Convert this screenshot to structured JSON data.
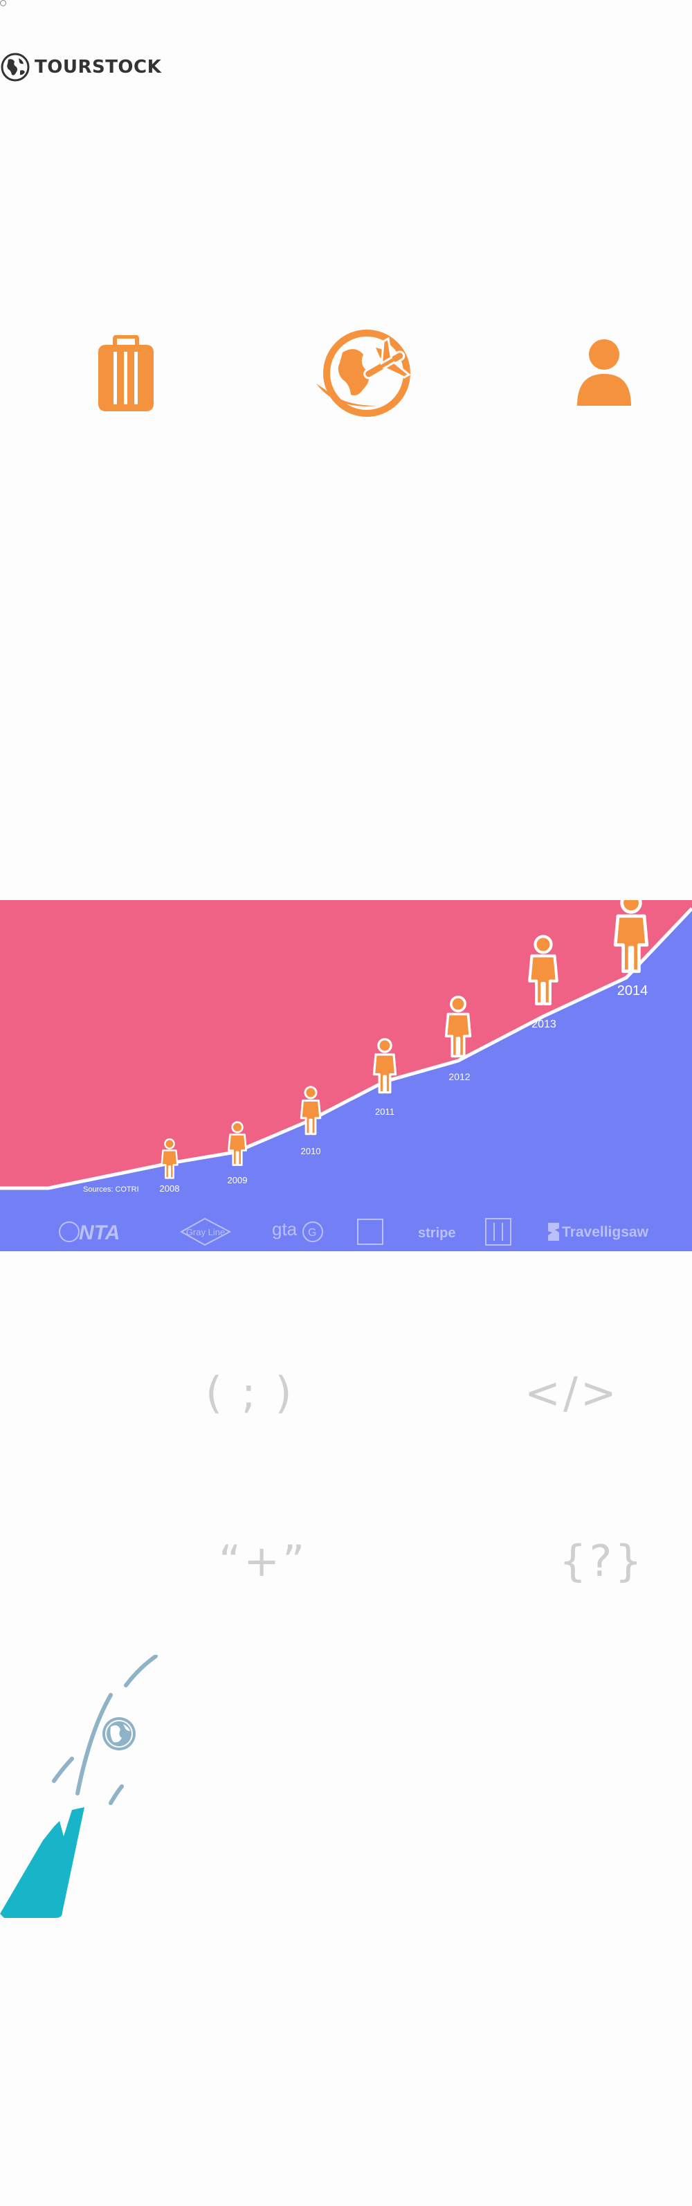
{
  "brand": {
    "name": "TOURSTOCK",
    "icon": "globe-icon",
    "color": "#333333"
  },
  "features": [
    {
      "icon": "luggage-icon"
    },
    {
      "icon": "globe-plane-icon"
    },
    {
      "icon": "person-icon"
    }
  ],
  "growth": {
    "source": "Sources: COTRI",
    "years": [
      "2008",
      "2009",
      "2010",
      "2011",
      "2012",
      "2013",
      "2014"
    ],
    "colors": {
      "top": "#F06285",
      "bottom": "#737FF5",
      "accent": "#F5923E"
    },
    "partners": [
      "NTA",
      "Gray Line",
      "gta",
      "stripe",
      "Travelligsaw"
    ]
  },
  "code_symbols": [
    "( ; )",
    "</>",
    "“+”",
    "{?}"
  ],
  "rocket": {
    "icon": "rocket-globe-icon"
  }
}
